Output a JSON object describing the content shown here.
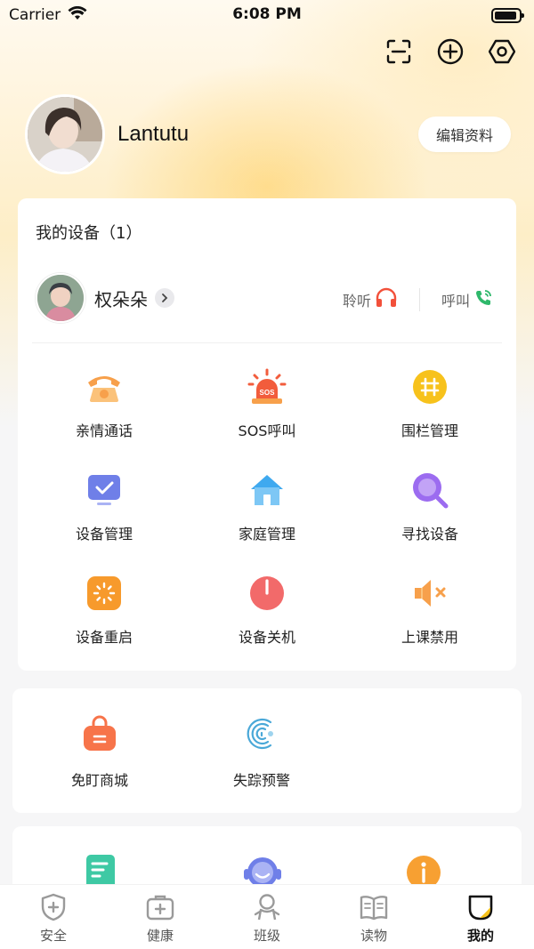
{
  "status_bar": {
    "carrier": "Carrier",
    "time": "6:08 PM"
  },
  "top_actions": {
    "icons": [
      "scan-icon",
      "add-circle-icon",
      "settings-hex-icon"
    ]
  },
  "profile": {
    "name": "Lantutu",
    "edit_label": "编辑资料"
  },
  "devices": {
    "title": "我的设备（1）",
    "device": {
      "name": "权朵朵",
      "listen_label": "聆听",
      "call_label": "呼叫"
    },
    "functions": [
      {
        "label": "亲情通话",
        "icon": "phone-icon",
        "color": "#f7a04b"
      },
      {
        "label": "SOS呼叫",
        "icon": "sos-alarm-icon",
        "color": "#f25c3c"
      },
      {
        "label": "围栏管理",
        "icon": "fence-icon",
        "color": "#f7c21c"
      },
      {
        "label": "设备管理",
        "icon": "monitor-check-icon",
        "color": "#6f7fe8"
      },
      {
        "label": "家庭管理",
        "icon": "home-icon",
        "color": "#3fa9ef"
      },
      {
        "label": "寻找设备",
        "icon": "search-device-icon",
        "color": "#9c6cf0"
      },
      {
        "label": "设备重启",
        "icon": "restart-icon",
        "color": "#f79a2c"
      },
      {
        "label": "设备关机",
        "icon": "power-icon",
        "color": "#f26a6a"
      },
      {
        "label": "上课禁用",
        "icon": "mute-icon",
        "color": "#f7a04b"
      }
    ]
  },
  "mall": {
    "items": [
      {
        "label": "免盯商城",
        "icon": "shopping-bag-icon",
        "color": "#f7744a"
      },
      {
        "label": "失踪预警",
        "icon": "fingerprint-icon",
        "color": "#4aa8d8"
      }
    ]
  },
  "more": {
    "icons": [
      {
        "icon": "document-icon",
        "color": "#3ec9a4"
      },
      {
        "icon": "service-icon",
        "color": "#6f7fe8"
      },
      {
        "icon": "info-icon",
        "color": "#f7a032"
      }
    ]
  },
  "tabbar": {
    "tabs": [
      {
        "label": "安全",
        "icon": "shield-icon"
      },
      {
        "label": "健康",
        "icon": "medkit-icon"
      },
      {
        "label": "班级",
        "icon": "class-icon"
      },
      {
        "label": "读物",
        "icon": "book-icon"
      },
      {
        "label": "我的",
        "icon": "profile-icon"
      }
    ],
    "active_index": 4
  }
}
